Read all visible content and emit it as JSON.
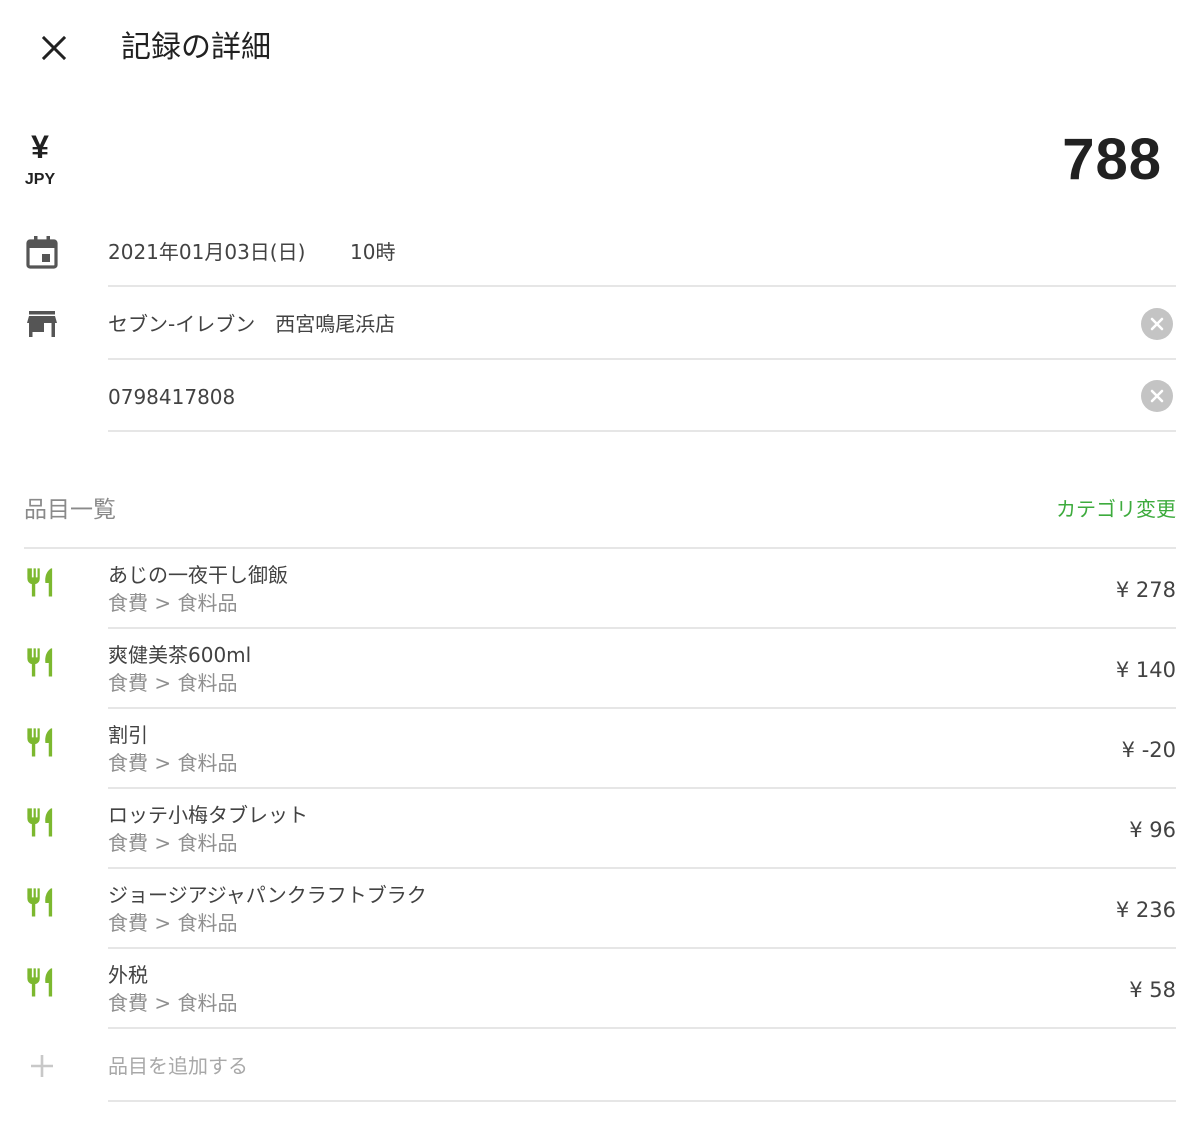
{
  "header": {
    "title": "記録の詳細",
    "close_icon": "close-icon"
  },
  "amount": {
    "currency_symbol": "¥",
    "currency_code": "JPY",
    "total": "788"
  },
  "date": {
    "date_text": "2021年01月03日(日)",
    "time_text": "10時"
  },
  "store": {
    "name": "セブン-イレブン　西宮鳴尾浜店",
    "phone": "0798417808"
  },
  "items_section": {
    "title": "品目一覧",
    "change_category_label": "カテゴリ変更"
  },
  "items": [
    {
      "name": "あじの一夜干し御飯",
      "category": "食費 > 食料品",
      "price": "¥ 278"
    },
    {
      "name": "爽健美茶600ml",
      "category": "食費 > 食料品",
      "price": "¥ 140"
    },
    {
      "name": "割引",
      "category": "食費 > 食料品",
      "price": "¥ -20"
    },
    {
      "name": "ロッテ小梅タブレット",
      "category": "食費 > 食料品",
      "price": "¥ 96"
    },
    {
      "name": "ジョージアジャパンクラフトブラク",
      "category": "食費 > 食料品",
      "price": "¥ 236"
    },
    {
      "name": "外税",
      "category": "食費 > 食料品",
      "price": "¥ 58"
    }
  ],
  "add_item": {
    "label": "品目を追加する"
  },
  "colors": {
    "accent_green": "#3dab3d",
    "food_icon_green": "#7cb82f",
    "icon_gray": "#555555"
  }
}
